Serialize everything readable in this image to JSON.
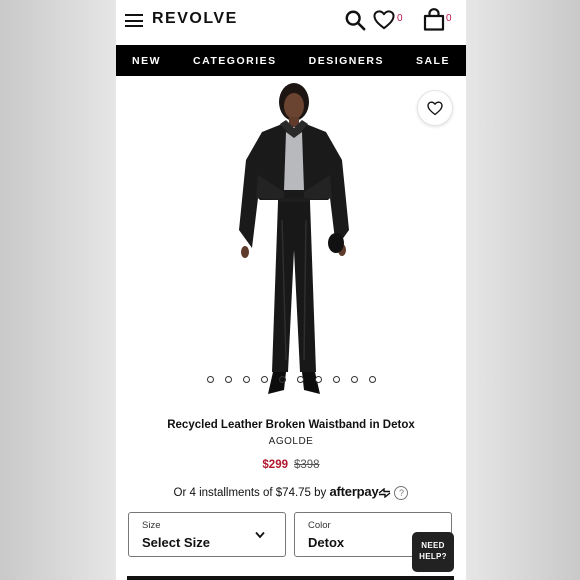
{
  "header": {
    "logo": "REVOLVE",
    "wishlist_count": "0",
    "bag_count": "0"
  },
  "nav": {
    "items": [
      "NEW",
      "CATEGORIES",
      "DESIGNERS",
      "SALE"
    ]
  },
  "product": {
    "title": "Recycled Leather Broken Waistband in Detox",
    "brand": "AGOLDE",
    "sale_price": "$299",
    "original_price": "$398",
    "installments_text": "Or 4 installments of $74.75 by",
    "afterpay_label": "afterpay",
    "image_count": 10,
    "active_image_index": 4
  },
  "selectors": {
    "size_label": "Size",
    "size_value": "Select Size",
    "color_label": "Color",
    "color_value": "Detox"
  },
  "help": {
    "line1": "NEED",
    "line2": "HELP?"
  },
  "colors": {
    "accent": "#c2185b",
    "sale_red": "#b0172d",
    "nav_bg": "#000000"
  }
}
